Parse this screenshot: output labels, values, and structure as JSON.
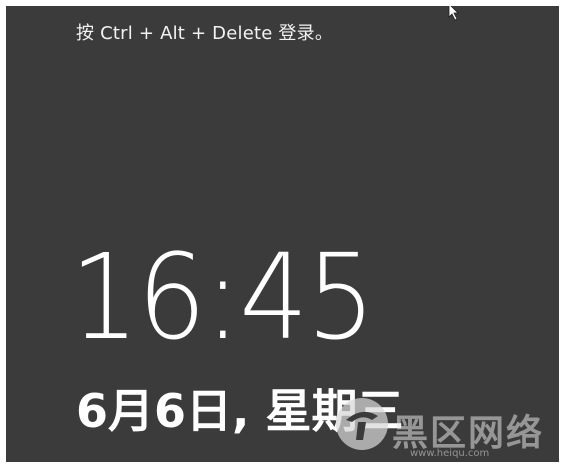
{
  "lock_screen": {
    "hint": "按 Ctrl + Alt + Delete 登录。",
    "time": "16:45",
    "date": "6月6日, 星期三"
  },
  "watermark": {
    "name": "黑区网络",
    "url": "www.heiqu.com"
  },
  "colors": {
    "background": "#3b3b3b",
    "text": "#ffffff"
  },
  "icons": {
    "cursor": "mouse-pointer-icon",
    "watermark_logo": "watermark-logo-icon"
  }
}
